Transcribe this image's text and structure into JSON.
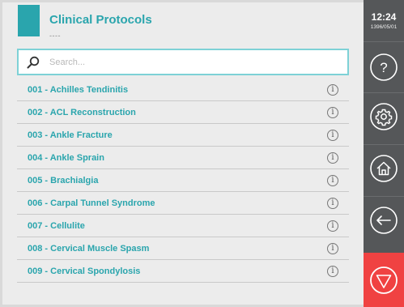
{
  "header": {
    "title": "Clinical Protocols",
    "subtitle": "----"
  },
  "search": {
    "placeholder": "Search...",
    "value": ""
  },
  "protocols": [
    "001 - Achilles Tendinitis",
    "002 - ACL Reconstruction",
    "003 - Ankle Fracture",
    "004 - Ankle Sprain",
    "005 - Brachialgia",
    "006 - Carpal Tunnel Syndrome",
    "007 - Cellulite",
    "008 - Cervical Muscle Spasm",
    "009 - Cervical Spondylosis"
  ],
  "status": {
    "time": "12:24",
    "date": "1396/05/01"
  },
  "sidebar": {
    "buttons": [
      "help-icon",
      "settings-icon",
      "home-icon",
      "back-icon",
      "stop-icon"
    ]
  },
  "colors": {
    "accent": "#2aa5ad",
    "sidebar": "#555759",
    "stop": "#f04242"
  }
}
